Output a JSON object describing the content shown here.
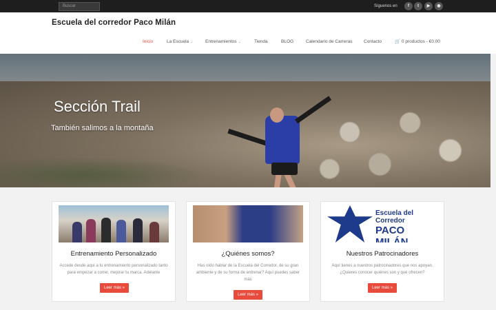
{
  "topbar": {
    "search_placeholder": "Buscar",
    "follow_label": "Síguenos en",
    "social": [
      {
        "icon": "facebook-icon",
        "glyph": "f"
      },
      {
        "icon": "twitter-icon",
        "glyph": "t"
      },
      {
        "icon": "youtube-icon",
        "glyph": "▶"
      },
      {
        "icon": "rss-icon",
        "glyph": "◉"
      }
    ]
  },
  "header": {
    "site_title": "Escuela del corredor Paco Milán",
    "nav": [
      {
        "label": "Inicio",
        "active": true
      },
      {
        "label": "La Escuela",
        "dropdown": true
      },
      {
        "label": "Entrenamientos",
        "dropdown": true
      },
      {
        "label": "Tienda"
      },
      {
        "label": "BLOG"
      },
      {
        "label": "Calendario de Carreras"
      },
      {
        "label": "Contacto"
      },
      {
        "label": "0 productos - €0.00",
        "icon": "cart-icon"
      }
    ]
  },
  "hero": {
    "title": "Sección Trail",
    "subtitle": "También salimos a la montaña"
  },
  "cards": [
    {
      "title": "Entrenamiento Personalizado",
      "text": "Accede desde aquí a tu entrenamiento personalizado tanto para empezar a correr, mejorar tu marca. Adelante",
      "button": "Leer más »"
    },
    {
      "title": "¿Quiénes somos?",
      "text": "Has oído hablar de la Escuela del Corredor, de su gran ambiente y de su forma de entrenar? Aquí puedes saber más",
      "button": "Leer más »"
    },
    {
      "title": "Nuestros Patrocinadores",
      "text": "Aquí tienes a nuestros patrocinadores que nos apoyan. ¿Quieres conocer quiénes son y qué ofrecen?",
      "button": "Leer más »",
      "logo_line1": "Escuela del Corredor",
      "logo_line2": "PACO MILÁN"
    }
  ],
  "colors": {
    "accent": "#e84b3c",
    "topbar": "#1e1e1e",
    "logo_blue": "#1e3a8a"
  }
}
